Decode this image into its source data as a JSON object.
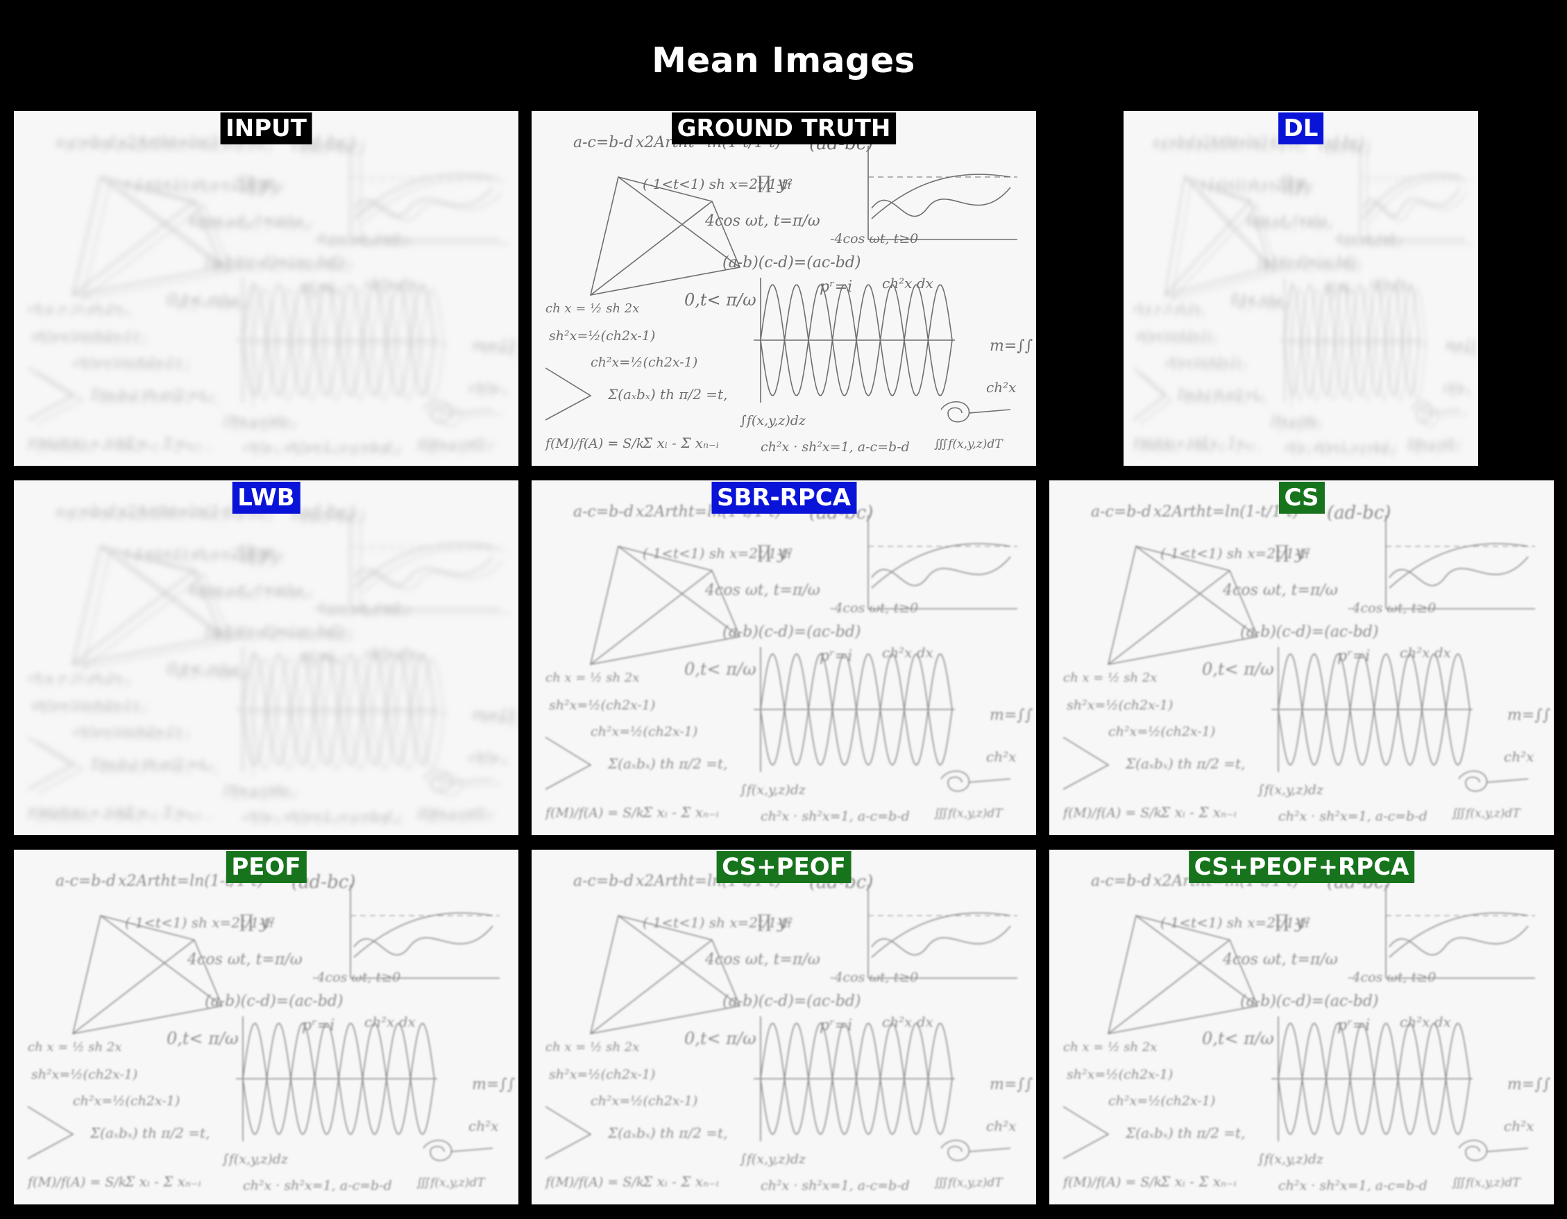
{
  "figure": {
    "title": "Mean Images"
  },
  "panels": [
    {
      "label": "INPUT",
      "badge_color": "#000000",
      "quality": "blurred"
    },
    {
      "label": "GROUND TRUTH",
      "badge_color": "#000000",
      "quality": "sharp"
    },
    {
      "label": "DL",
      "badge_color": "#0a14d8",
      "quality": "blurred"
    },
    {
      "label": "LWB",
      "badge_color": "#0a14d8",
      "quality": "blurred"
    },
    {
      "label": "SBR-RPCA",
      "badge_color": "#0a14d8",
      "quality": "sharp"
    },
    {
      "label": "CS",
      "badge_color": "#17741d",
      "quality": "sharp"
    },
    {
      "label": "PEOF",
      "badge_color": "#17741d",
      "quality": "sharp"
    },
    {
      "label": "CS+PEOF",
      "badge_color": "#17741d",
      "quality": "sharp"
    },
    {
      "label": "CS+PEOF+RPCA",
      "badge_color": "#17741d",
      "quality": "sharp"
    }
  ],
  "formula_texts": {
    "t1": "a-c=b-d",
    "t2": "x2Artht=ln(1-t/1-t)",
    "t3": "(ad-bc)",
    "t4": "(-1<t<1) sh x=2t/1-t²",
    "t5": "∏ yᵢ",
    "t6": "4cos ωt, t=π/ω",
    "t7": "(a-b)(c-d)=(ac-bd)",
    "t8": "-4cos ωt, t≥0",
    "t9": "pʳ=i",
    "t10": "ch²x dx",
    "t11": "0,t< π/ω",
    "t12": "ch x = ½ sh 2x",
    "t13": "sh²x=½(ch2x-1)",
    "t14": "ch²x=½(ch2x-1)",
    "t15": "Σ(aₓbₓ)  th π/2 =t,",
    "t16": "∫f(x,y,z)dz",
    "t17": "f(M)/f(A) = S/k",
    "t18": "Σ xᵢ - Σ xₙ₋ᵢ",
    "t19": "ch²x · sh²x=1,  a-c=b-d",
    "t20": "∭f(x,y,z)dT",
    "t21": "m=∫∫",
    "t22": "ch²x"
  }
}
